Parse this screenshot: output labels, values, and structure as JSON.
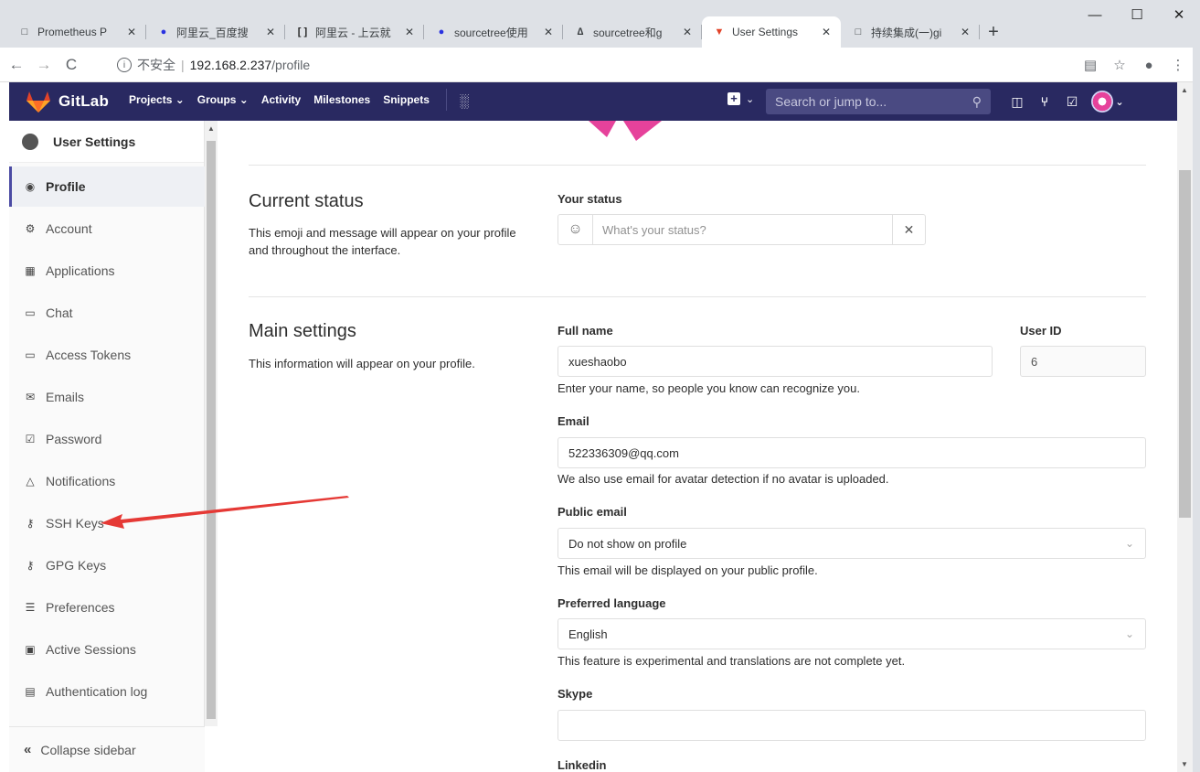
{
  "browser": {
    "tabs": [
      {
        "title": "Prometheus P",
        "icon": "page-icon"
      },
      {
        "title": "阿里云_百度搜",
        "icon": "baidu-icon"
      },
      {
        "title": "阿里云 - 上云就",
        "icon": "aliyun-icon"
      },
      {
        "title": "sourcetree使用",
        "icon": "baidu-icon"
      },
      {
        "title": "sourcetree和g",
        "icon": "sourcetree-icon"
      },
      {
        "title": "User Settings",
        "icon": "gitlab-icon",
        "active": true
      },
      {
        "title": "持续集成(一)gi",
        "icon": "page-icon"
      }
    ],
    "url_insecure": "不安全",
    "url_host": "192.168.2.237",
    "url_path": "/profile"
  },
  "gitlab_nav": {
    "brand": "GitLab",
    "menu": [
      "Projects ⌄",
      "Groups ⌄",
      "Activity",
      "Milestones",
      "Snippets"
    ],
    "search_placeholder": "Search or jump to...",
    "brand_color": "#292961",
    "logo_color": "#e24329"
  },
  "sidebar": {
    "title": "User Settings",
    "items": [
      {
        "label": "Profile",
        "icon": "profile-icon",
        "active": true
      },
      {
        "label": "Account",
        "icon": "account-icon"
      },
      {
        "label": "Applications",
        "icon": "applications-icon"
      },
      {
        "label": "Chat",
        "icon": "chat-icon"
      },
      {
        "label": "Access Tokens",
        "icon": "token-icon"
      },
      {
        "label": "Emails",
        "icon": "email-icon"
      },
      {
        "label": "Password",
        "icon": "lock-icon"
      },
      {
        "label": "Notifications",
        "icon": "bell-icon"
      },
      {
        "label": "SSH Keys",
        "icon": "key-icon"
      },
      {
        "label": "GPG Keys",
        "icon": "key-icon"
      },
      {
        "label": "Preferences",
        "icon": "preferences-icon"
      },
      {
        "label": "Active Sessions",
        "icon": "monitor-icon"
      },
      {
        "label": "Authentication log",
        "icon": "log-icon"
      }
    ],
    "collapse_label": "Collapse sidebar"
  },
  "status_section": {
    "title": "Current status",
    "description": "This emoji and message will appear on your profile and throughout the interface.",
    "label": "Your status",
    "placeholder": "What's your status?"
  },
  "main_settings": {
    "title": "Main settings",
    "description": "This information will appear on your profile.",
    "full_name_label": "Full name",
    "full_name_value": "xueshaobo",
    "full_name_help": "Enter your name, so people you know can recognize you.",
    "user_id_label": "User ID",
    "user_id_value": "6",
    "email_label": "Email",
    "email_value": "522336309@qq.com",
    "email_help": "We also use email for avatar detection if no avatar is uploaded.",
    "public_email_label": "Public email",
    "public_email_value": "Do not show on profile",
    "public_email_help": "This email will be displayed on your public profile.",
    "language_label": "Preferred language",
    "language_value": "English",
    "language_help": "This feature is experimental and translations are not complete yet.",
    "skype_label": "Skype",
    "skype_value": "",
    "linkedin_label": "Linkedin"
  },
  "annotation_color": "#e53935"
}
